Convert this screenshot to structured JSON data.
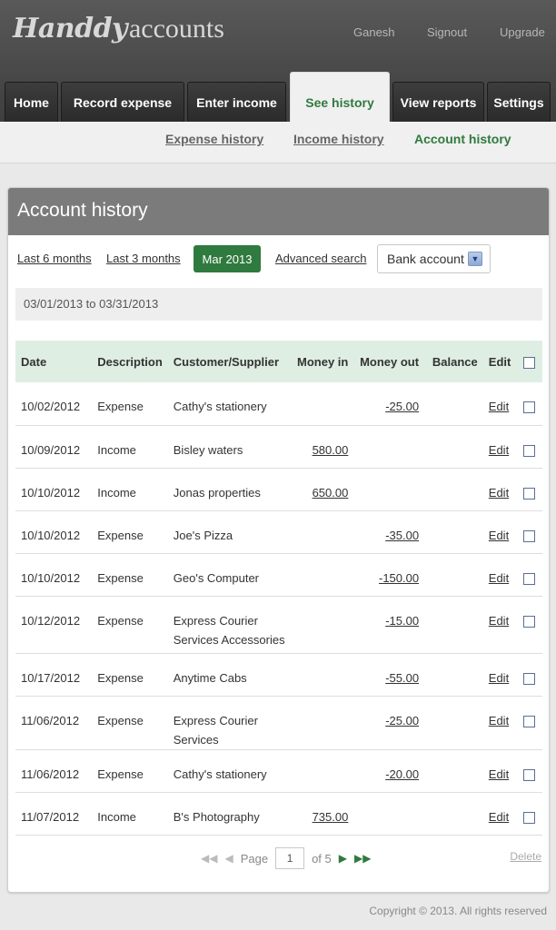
{
  "app": {
    "logo_script": "Handdy",
    "logo_plain": "accounts"
  },
  "toplinks": [
    "Ganesh",
    "Signout",
    "Upgrade"
  ],
  "tabs": [
    "Home",
    "Record expense",
    "Enter income",
    "See history",
    "View reports",
    "Settings"
  ],
  "active_tab": "See history",
  "subnav": [
    "Expense history",
    "Income history",
    "Account history"
  ],
  "active_subnav": "Account history",
  "panel": {
    "title": "Account history"
  },
  "filters": {
    "last6": "Last 6 months",
    "last3": "Last 3 months",
    "current": "Mar 2013",
    "advanced": "Advanced search"
  },
  "account_select": {
    "value": "Bank account"
  },
  "date_range": "03/01/2013 to 03/31/2013",
  "table": {
    "headers": [
      "Date",
      "Description",
      "Customer/Supplier",
      "Money in",
      "Money out",
      "Balance",
      "Edit"
    ],
    "rows": [
      {
        "date": "10/02/2012",
        "desc": "Expense",
        "party": "Cathy's stationery",
        "in": "",
        "out": "-25.00",
        "balance": "",
        "edit": "Edit"
      },
      {
        "date": "10/09/2012",
        "desc": "Income",
        "party": "Bisley waters",
        "in": "580.00",
        "out": "",
        "balance": "",
        "edit": "Edit"
      },
      {
        "date": "10/10/2012",
        "desc": "Income",
        "party": "Jonas properties",
        "in": "650.00",
        "out": "",
        "balance": "",
        "edit": "Edit"
      },
      {
        "date": "10/10/2012",
        "desc": "Expense",
        "party": "Joe's Pizza",
        "in": "",
        "out": "-35.00",
        "balance": "",
        "edit": "Edit"
      },
      {
        "date": "10/10/2012",
        "desc": "Expense",
        "party": "Geo's Computer",
        "in": "",
        "out": "-150.00",
        "balance": "",
        "edit": "Edit"
      },
      {
        "date": "10/12/2012",
        "desc": "Expense",
        "party": "Express Courier Services Accessories",
        "in": "",
        "out": "-15.00",
        "balance": "",
        "edit": "Edit"
      },
      {
        "date": "10/17/2012",
        "desc": "Expense",
        "party": "Anytime Cabs",
        "in": "",
        "out": "-55.00",
        "balance": "",
        "edit": "Edit"
      },
      {
        "date": "11/06/2012",
        "desc": "Expense",
        "party": "Express Courier Services",
        "in": "",
        "out": "-25.00",
        "balance": "",
        "edit": "Edit"
      },
      {
        "date": "11/06/2012",
        "desc": "Expense",
        "party": "Cathy's stationery",
        "in": "",
        "out": "-20.00",
        "balance": "",
        "edit": "Edit"
      },
      {
        "date": "11/07/2012",
        "desc": "Income",
        "party": "B's Photography",
        "in": "735.00",
        "out": "",
        "balance": "",
        "edit": "Edit"
      }
    ]
  },
  "pager": {
    "label": "Page",
    "current": "1",
    "of": "of 5"
  },
  "delete_label": "Delete",
  "footer": "Copyright © 2013. All rights reserved",
  "colors": {
    "accent": "#2f7a3e",
    "header": "#4a4a4a",
    "panel_head": "#7b7b7b",
    "table_head": "#dfeee3"
  }
}
